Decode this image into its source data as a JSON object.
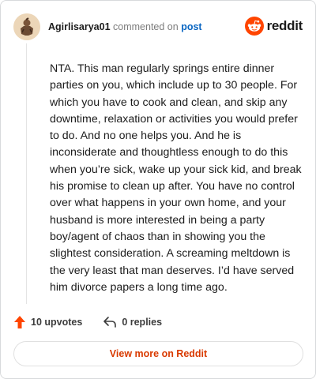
{
  "header": {
    "username": "Agirlisarya01",
    "action_text": "commented on",
    "target_link": "post",
    "brand_name": "reddit"
  },
  "comment": {
    "body": "NTA. This man regularly springs entire dinner parties on you, which include up to 30 people. For which you have to cook and clean, and skip any downtime, relaxation or activities you would prefer to do. And no one helps you. And he is inconsiderate and thoughtless enough to do this when you’re sick, wake up your sick kid, and break his promise to clean up after. You have no control over what happens in your own home, and your husband is more interested in being a party boy/agent of chaos than in showing you the slightest consideration. A screaming meltdown is the very least that man deserves. I’d have served him divorce papers a long time ago."
  },
  "actions": {
    "upvotes_label": "10 upvotes",
    "replies_label": "0 replies"
  },
  "footer": {
    "view_more_label": "View more on Reddit"
  },
  "colors": {
    "brand_orange": "#ff4500",
    "link_blue": "#0a66c2",
    "cta_text": "#d93a00"
  },
  "icons": {
    "avatar": "avatar",
    "brand": "reddit-logo-icon",
    "upvote": "upvote-arrow-icon",
    "reply": "reply-icon"
  }
}
